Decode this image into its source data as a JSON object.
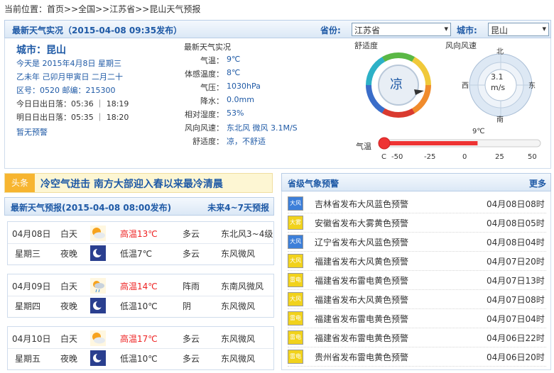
{
  "breadcrumb": {
    "label": "当前位置：",
    "path": "首页>>全国>>江苏省>>昆山天气预报"
  },
  "live": {
    "title": "最新天气实况（2015-04-08 09:35发布）",
    "province_label": "省份:",
    "province_value": "江苏省",
    "city_label": "城市:",
    "city_value": "昆山",
    "city_name": "城市：昆山",
    "today": "今天是 2015年4月8日 星期三",
    "lunar": "乙未年 己卯月甲寅日 二月二十",
    "codes": "区号：0520   邮编：215300",
    "sun_today": "今日日出日落：05:36 ｜ 18:19",
    "sun_tomorrow": "明日日出日落：05:35 ｜ 18:20",
    "alarm": "暂无预警",
    "latest_label": "最新天气实况",
    "kv": [
      {
        "label": "气温：",
        "value": "9℃"
      },
      {
        "label": "体感温度：",
        "value": "8℃"
      },
      {
        "label": "气压：",
        "value": "1030hPa"
      },
      {
        "label": "降水：",
        "value": "0.0mm"
      },
      {
        "label": "相对湿度：",
        "value": "53%"
      },
      {
        "label": "风向风速：",
        "value": "东北风 微风 3.1M/S"
      },
      {
        "label": "舒适度：",
        "value": "凉，不舒适"
      }
    ],
    "comfort_title": "舒适度",
    "comfort_value": "凉",
    "wind_title": "风向风速",
    "wind_value_line1": "3.1",
    "wind_value_line2": "m/s",
    "compass": {
      "n": "北",
      "s": "南",
      "e": "东",
      "w": "西"
    },
    "temp_label": "气温",
    "temp_value_label": "9℃",
    "temp_value": 9,
    "temp_scale_label": "C",
    "temp_ticks": [
      "-50",
      "-25",
      "0",
      "25",
      "50"
    ]
  },
  "headline": {
    "tag": "头条",
    "text": "冷空气进击  南方大部迎入春以来最冷清晨"
  },
  "forecast": {
    "title": "最新天气预报(2015-04-08 08:00发布)",
    "more": "未来4~7天预报",
    "days": [
      {
        "date": "04月08日",
        "week": "星期三",
        "day": {
          "period": "白天",
          "temp": "高温13℃",
          "wx": "多云",
          "wind": "东北风3~4级"
        },
        "night": {
          "period": "夜晚",
          "temp": "低温7℃",
          "wx": "多云",
          "wind": "东风微风"
        }
      },
      {
        "date": "04月09日",
        "week": "星期四",
        "day": {
          "period": "白天",
          "temp": "高温14℃",
          "wx": "阵雨",
          "wind": "东南风微风"
        },
        "night": {
          "period": "夜晚",
          "temp": "低温10℃",
          "wx": "阴",
          "wind": "东风微风"
        }
      },
      {
        "date": "04月10日",
        "week": "星期五",
        "day": {
          "period": "白天",
          "temp": "高温17℃",
          "wx": "多云",
          "wind": "东风微风"
        },
        "night": {
          "period": "夜晚",
          "temp": "低温10℃",
          "wx": "多云",
          "wind": "东风微风"
        }
      }
    ]
  },
  "warnings": {
    "title": "省级气象预警",
    "more": "更多",
    "items": [
      {
        "text": "吉林省发布大风蓝色预警",
        "time": "04月08日08时",
        "level": "blue",
        "icon": "大风"
      },
      {
        "text": "安徽省发布大雾黄色预警",
        "time": "04月08日05时",
        "level": "yellow",
        "icon": "大雾"
      },
      {
        "text": "辽宁省发布大风蓝色预警",
        "time": "04月08日04时",
        "level": "blue",
        "icon": "大风"
      },
      {
        "text": "福建省发布大风黄色预警",
        "time": "04月07日20时",
        "level": "yellow",
        "icon": "大风"
      },
      {
        "text": "福建省发布雷电黄色预警",
        "time": "04月07日13时",
        "level": "yellow",
        "icon": "雷电"
      },
      {
        "text": "福建省发布大风黄色预警",
        "time": "04月07日08时",
        "level": "yellow",
        "icon": "大风"
      },
      {
        "text": "福建省发布雷电黄色预警",
        "time": "04月07日04时",
        "level": "yellow",
        "icon": "雷电"
      },
      {
        "text": "福建省发布雷电黄色预警",
        "time": "04月06日22时",
        "level": "yellow",
        "icon": "雷电"
      },
      {
        "text": "贵州省发布雷电黄色预警",
        "time": "04月06日20时",
        "level": "yellow",
        "icon": "雷电"
      }
    ]
  },
  "colors": {
    "brand_blue": "#1f5aa6",
    "high_red": "#e22",
    "warn_blue": "#3d7fd9",
    "warn_yellow": "#f1d21c"
  }
}
